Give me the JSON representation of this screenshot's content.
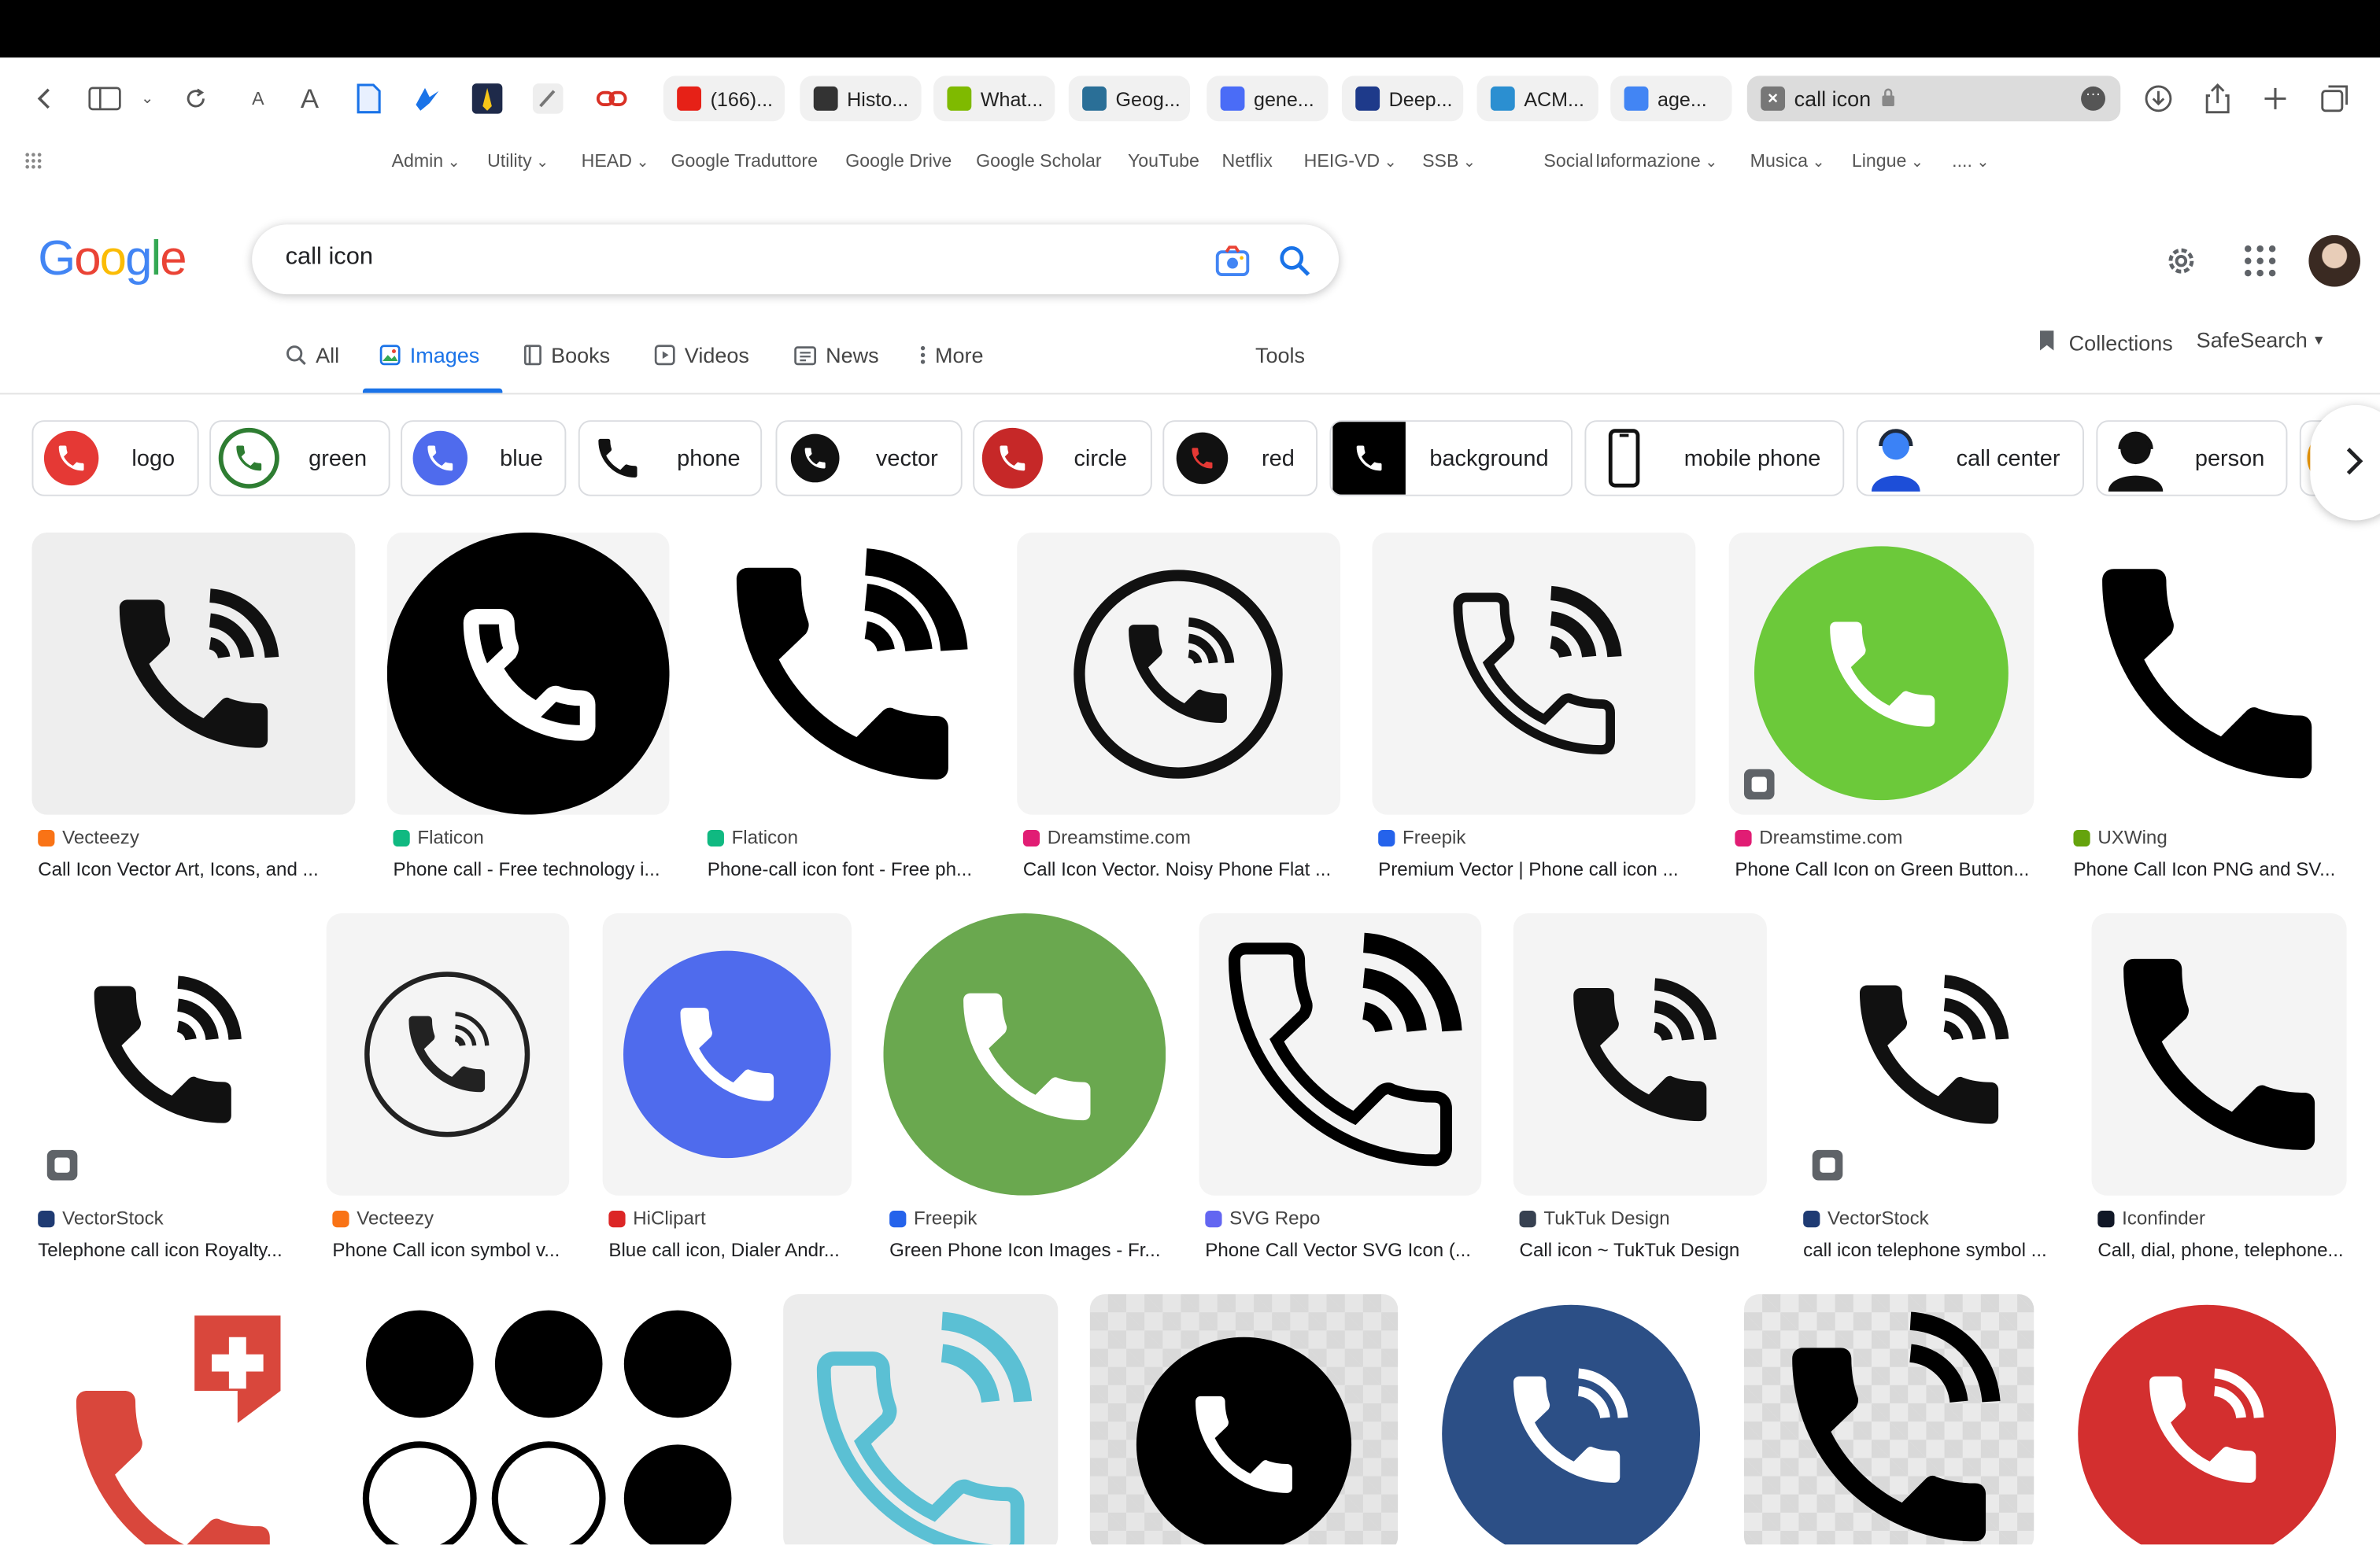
{
  "browser": {
    "tabs": [
      {
        "label": "(166)...",
        "color": "#e62117"
      },
      {
        "label": "Histo...",
        "color": "#333333"
      },
      {
        "label": "What...",
        "color": "#7fba00"
      },
      {
        "label": "Geog...",
        "color": "#2a6f97"
      },
      {
        "label": "gene...",
        "color": "#4a6cf7"
      },
      {
        "label": "Deep...",
        "color": "#1e3a8a"
      },
      {
        "label": "ACM...",
        "color": "#2b8fd1"
      },
      {
        "label": "age...",
        "color": "#4285f4"
      }
    ],
    "active_tab": {
      "label": "call icon"
    },
    "text_size_small": "A",
    "text_size_large": "A"
  },
  "bookmarks": [
    {
      "label": "Admin",
      "dropdown": true
    },
    {
      "label": "Utility",
      "dropdown": true
    },
    {
      "label": "HEAD",
      "dropdown": true
    },
    {
      "label": "Google Traduttore",
      "dropdown": false
    },
    {
      "label": "Google Drive",
      "dropdown": false
    },
    {
      "label": "Google Scholar",
      "dropdown": false
    },
    {
      "label": "YouTube",
      "dropdown": false
    },
    {
      "label": "Netflix",
      "dropdown": false
    },
    {
      "label": "HEIG-VD",
      "dropdown": true
    },
    {
      "label": "SSB",
      "dropdown": true
    },
    {
      "label": "Social",
      "dropdown": true
    },
    {
      "label": "Informazione",
      "dropdown": true
    },
    {
      "label": "Musica",
      "dropdown": true
    },
    {
      "label": "Lingue",
      "dropdown": true
    },
    {
      "label": "....",
      "dropdown": true
    }
  ],
  "google": {
    "logo": "Google",
    "query": "call icon",
    "tabs": [
      {
        "label": "All",
        "icon": "search-icon"
      },
      {
        "label": "Images",
        "icon": "image-icon",
        "active": true
      },
      {
        "label": "Books",
        "icon": "book-icon"
      },
      {
        "label": "Videos",
        "icon": "video-icon"
      },
      {
        "label": "News",
        "icon": "news-icon"
      },
      {
        "label": "More",
        "icon": "more-vert-icon"
      }
    ],
    "tools": "Tools",
    "collections": "Collections",
    "safesearch": "SafeSearch",
    "accent": "#1a73e8"
  },
  "chips": [
    {
      "label": "logo"
    },
    {
      "label": "green"
    },
    {
      "label": "blue"
    },
    {
      "label": "phone"
    },
    {
      "label": "vector"
    },
    {
      "label": "circle"
    },
    {
      "label": "red"
    },
    {
      "label": "background"
    },
    {
      "label": "mobile phone"
    },
    {
      "label": "call center"
    },
    {
      "label": "person"
    }
  ],
  "results": [
    {
      "source": "Vecteezy",
      "title": "Call Icon Vector Art, Icons, and ...",
      "fav": "#f97316"
    },
    {
      "source": "Flaticon",
      "title": "Phone call - Free technology i...",
      "fav": "#10b981"
    },
    {
      "source": "Flaticon",
      "title": "Phone-call icon font - Free ph...",
      "fav": "#10b981"
    },
    {
      "source": "Dreamstime.com",
      "title": "Call Icon Vector. Noisy Phone Flat ...",
      "fav": "#e11d74"
    },
    {
      "source": "Freepik",
      "title": "Premium Vector | Phone call icon ...",
      "fav": "#2563eb"
    },
    {
      "source": "Dreamstime.com",
      "title": "Phone Call Icon on Green Button...",
      "fav": "#e11d74"
    },
    {
      "source": "UXWing",
      "title": "Phone Call Icon PNG and SV...",
      "fav": "#65a30d"
    },
    {
      "source": "VectorStock",
      "title": "Telephone call icon Royalty...",
      "fav": "#1f3b73"
    },
    {
      "source": "Vecteezy",
      "title": "Phone Call icon symbol v...",
      "fav": "#f97316"
    },
    {
      "source": "HiClipart",
      "title": "Blue call icon, Dialer Andr...",
      "fav": "#dc2626"
    },
    {
      "source": "Freepik",
      "title": "Green Phone Icon Images - Fr...",
      "fav": "#2563eb"
    },
    {
      "source": "SVG Repo",
      "title": "Phone Call Vector SVG Icon (...",
      "fav": "#6366f1"
    },
    {
      "source": "TukTuk Design",
      "title": "Call icon ~ TukTuk Design",
      "fav": "#374151"
    },
    {
      "source": "VectorStock",
      "title": "call icon telephone symbol ...",
      "fav": "#1f3b73"
    },
    {
      "source": "Iconfinder",
      "title": "Call, dial, phone, telephone...",
      "fav": "#111827"
    }
  ]
}
